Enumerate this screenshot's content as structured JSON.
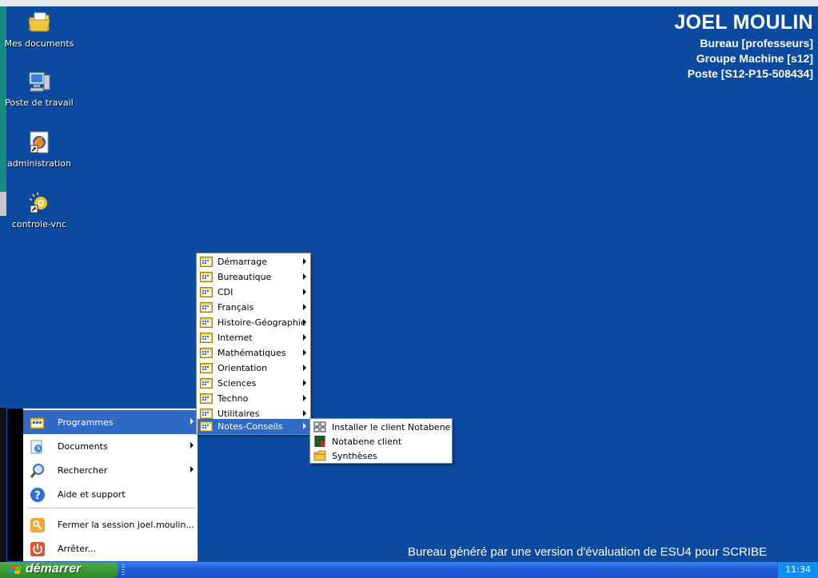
{
  "desktop": {
    "icons": [
      {
        "label": "Mes documents",
        "icon": "my-documents-icon"
      },
      {
        "label": "Poste de travail",
        "icon": "my-computer-icon"
      },
      {
        "label": "administration",
        "icon": "firefox-shortcut-icon"
      },
      {
        "label": "controle-vnc",
        "icon": "vnc-shortcut-icon"
      }
    ],
    "info": {
      "name": "JOEL MOULIN",
      "bureau": "Bureau [professeurs]",
      "groupe": "Groupe Machine [s12]",
      "poste": "Poste [S12-P15-508434]"
    },
    "banner": "Bureau généré par une version d'évaluation de ESU4 pour SCRIBE"
  },
  "start_menu": {
    "items": [
      {
        "label": "Programmes",
        "icon": "programs-icon",
        "has_submenu": true,
        "highlighted": true
      },
      {
        "label": "Documents",
        "icon": "documents-icon",
        "has_submenu": true
      },
      {
        "label": "Rechercher",
        "icon": "search-icon",
        "has_submenu": true
      },
      {
        "label": "Aide et support",
        "icon": "help-icon",
        "has_submenu": false
      },
      {
        "label": "Fermer la session joel.moulin...",
        "icon": "logoff-icon",
        "has_submenu": false
      },
      {
        "label": "Arrêter...",
        "icon": "shutdown-icon",
        "has_submenu": false
      }
    ]
  },
  "programs_menu": {
    "items": [
      "Démarrage",
      "Bureautique",
      "CDI",
      "Français",
      "Histoire-Géographie",
      "Internet",
      "Mathématiques",
      "Orientation",
      "Sciences",
      "Techno",
      "Utilitaires",
      "Notes-Conseils"
    ],
    "highlighted": "Notes-Conseils"
  },
  "notes_menu": {
    "items": [
      {
        "label": "Installer le client Notabene",
        "icon": "installer-icon"
      },
      {
        "label": "Notabene client",
        "icon": "notabene-icon"
      },
      {
        "label": "Synthèses",
        "icon": "folder-icon"
      }
    ]
  },
  "taskbar": {
    "start_label": "démarrer",
    "clock": "11:34"
  },
  "colors": {
    "desktop": "#0c4aa0",
    "highlight": "#316ac5",
    "taskbar": "#245edb",
    "start_button": "#3c9a36"
  }
}
